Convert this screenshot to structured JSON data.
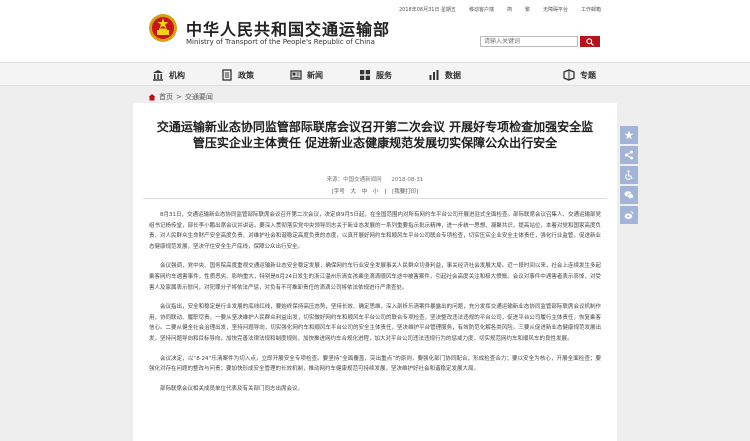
{
  "site": {
    "name_cn": "中华人民共和国交通运输部",
    "name_en": "Ministry of Transport of the People's Republic of China"
  },
  "topbar": {
    "date": "2018年08月31日 星期五",
    "links": [
      "移动客户端",
      "简",
      "繁",
      "无障碍平台",
      "工作邮箱"
    ]
  },
  "search": {
    "placeholder": "请输入关键词"
  },
  "nav": {
    "items": [
      {
        "label": "机构",
        "icon": "building-icon"
      },
      {
        "label": "政策",
        "icon": "document-icon"
      },
      {
        "label": "新闻",
        "icon": "newspaper-icon"
      },
      {
        "label": "服务",
        "icon": "service-icon"
      },
      {
        "label": "数据",
        "icon": "chart-icon"
      },
      {
        "label": "专题",
        "icon": "topic-icon"
      }
    ]
  },
  "breadcrumb": {
    "home": "首页",
    "sep": ">",
    "current": "交通要闻"
  },
  "article": {
    "title": "交通运输新业态协同监管部际联席会议召开第二次会议 开展好专项检查加强安全监管压实企业主体责任 促进新业态健康规范发展切实保障公众出行安全",
    "source": "来源：中国交通新闻网",
    "date": "2018-08-31",
    "font_label": "[字号",
    "font_large": "大",
    "font_medium": "中",
    "font_small": "小",
    "font_close": "]",
    "print_label": "[我要打印]",
    "paragraphs": [
      "8月31日，交通运输新业态协同监管部际联席会议召开第二次会议，决定自9月5日起，在全国范围内对所有网约车平台公司开展进驻式全面检查。部际联席会议召集人、交通运输部党组书记杨传堂，部长李小鹏出席会议并讲话，要深入贯彻落实党中央领导同志关于新业态发展的一系列重要指示批示精神，进一步统一思想、凝聚共识，提高站位，本着对党和国家高度负责、对人民群众生命财产安全高度负责、对维护社会和谐稳定高度负责的态度，以真开展好网约车和顺风车平台公司联合专项检查，切实压实企业安全主体责任，强化行业监管，促进新业态健康规范发展，坚决守住安全生产底线，保障公众出行安全。",
      "会议强调，党中央、国务院高度重视交通运输新业态安全稳定发展，确保网约车行业安全发展事关人民群众切身利益，事关经济社会发展大局。近一段时间以来，社会上连续发生多起乘客网约车遇害事件，性质恶劣、影响重大，特别是8月24日发生的浙江温州乐清女孩乘坐滴滴顺风车途中被害案件，引起社会高度关注和极大愤慨。会议对事件中遇害者表示哀悼，对受害人及家属表示慰问，对犯罪分子将依法严惩，对负有不可推卸责任的滴滴公司将依法依规进行严肃查处。",
      "会议指出，安全和稳定是行业发展的底线红线，要始终保持高压态势，坚持长效、确定思维，深入剖析乐清案件暴露出的问题，充分发挥交通运输新业态协同监管部际联席会议机制作用，协同联动、履职尽责。一要从坚决维护人民群众利益出发，切实做好网约车和顺风车平台公司的联合专项检查，坚决整改违法违规的平台公司，促进平台公司履行主体责任，恢复乘客信心。二要从健全社会治理出发，坚持问题导向，切实强化网约车和顺风车平台公司的安全主体责任，坚决维护平台管理服务，有效防范化解各类风险。三要从促进新业态健康规范发展出发，坚持问题导向和目标导向，加快完善法律法规和制度规则，加快推进网约车合规化进程，加大对平台公司违法违规行为的惩戒力度，切实规范网约车和顺风车的良性发展。",
      "会议决定，以“8·24”乐清案件为切入点，立即开展安全专项检查。要坚持“全面覆盖、突出重点”的原则，要强化部门协同配合，形成检查合力；要以安全为核心，开展全面检查；要强化对存在问题的整改与问责；要加快形成安全管理的长效机制，推动网约车健康规范可持续发展，坚决维护好社会和谐稳定发展大局。",
      "部际联席会议相关成员单位代表及有关部门同志出席会议。"
    ]
  },
  "floatbar": {
    "icons": [
      "star-icon",
      "share-icon",
      "accessibility-icon",
      "wechat-icon",
      "weibo-icon"
    ]
  },
  "colors": {
    "brand_red": "#b4141b",
    "nav_bg": "#f4f4f4",
    "page_bg": "#eeeeee",
    "float_btn": "#a4b4d6"
  }
}
